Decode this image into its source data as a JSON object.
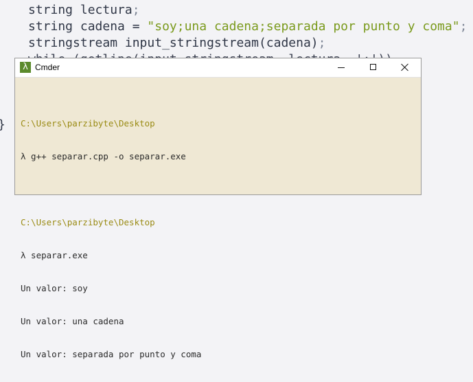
{
  "editor": {
    "line1": {
      "kw": "string",
      "rest": " lectura",
      "punc": ";"
    },
    "line2": {
      "kw": "string",
      "rest": " cadena = ",
      "str": "\"soy;una cadena;separada por punto y coma\"",
      "punc": ";"
    },
    "line3": {
      "kw": "stringstream",
      "rest": " input_stringstream(cadena)",
      "punc": ";"
    },
    "line4_partial": "while (getline(input_stringstream, lectura, ';'))",
    "closing_brace": "}"
  },
  "window": {
    "icon_glyph": "λ",
    "title": "Cmder",
    "minimize_icon": "minimize-icon",
    "maximize_icon": "maximize-icon",
    "close_icon": "close-icon"
  },
  "console": {
    "block1": {
      "path": "C:\\Users\\parzibyte\\Desktop",
      "command": "λ g++ separar.cpp -o separar.exe"
    },
    "block2": {
      "path": "C:\\Users\\parzibyte\\Desktop",
      "command": "λ separar.exe",
      "output": [
        "Un valor: soy",
        "Un valor: una cadena",
        "Un valor: separada por punto y coma"
      ]
    }
  },
  "colors": {
    "editor_bg": "#f3f3f6",
    "string_green": "#7a9a1c",
    "console_bg": "#efe8d4",
    "path_olive": "#9a8b14"
  }
}
